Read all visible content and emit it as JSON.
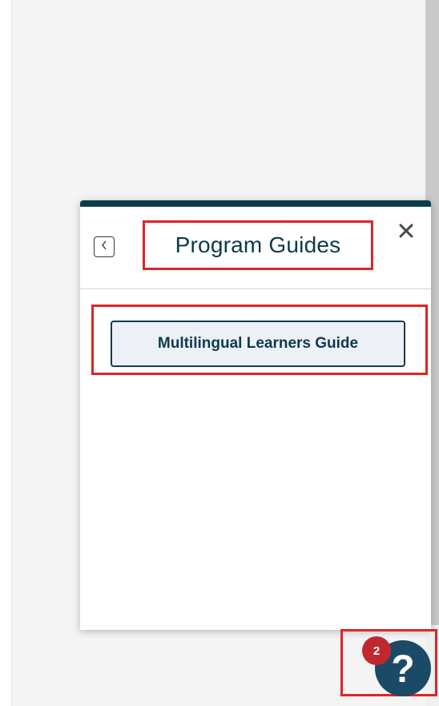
{
  "panel": {
    "title": "Program Guides",
    "guides": [
      {
        "label": "Multilingual Learners Guide"
      }
    ]
  },
  "help": {
    "glyph": "?",
    "badge_count": "2"
  },
  "colors": {
    "accent": "#0c3b4a",
    "help_button": "#1b4a66",
    "badge": "#c0282d",
    "highlight": "#e02424"
  },
  "icons": {
    "back": "chevron-left-icon",
    "close": "close-icon",
    "help": "question-icon"
  }
}
